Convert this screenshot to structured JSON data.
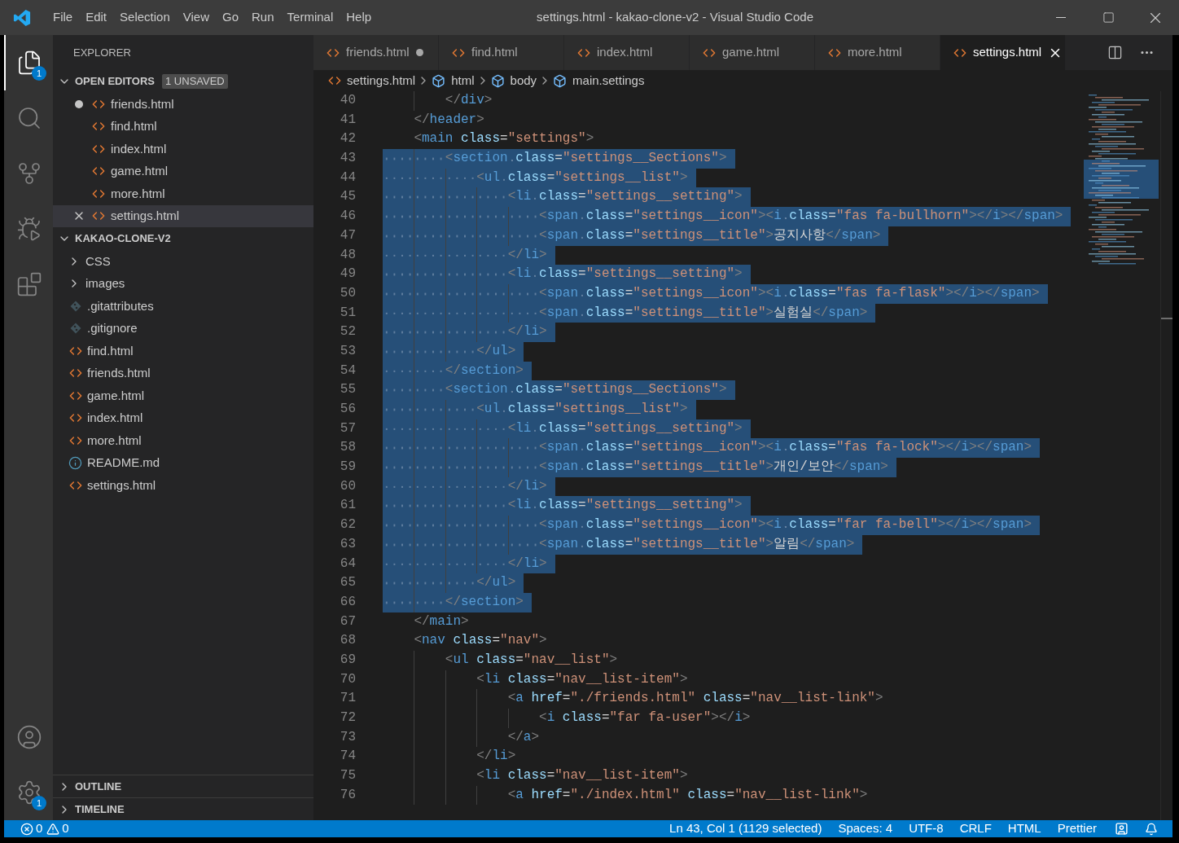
{
  "window": {
    "title": "settings.html - kakao-clone-v2 - Visual Studio Code"
  },
  "menu": [
    "File",
    "Edit",
    "Selection",
    "View",
    "Go",
    "Run",
    "Terminal",
    "Help"
  ],
  "activity_bar": [
    {
      "kind": "explorer",
      "selected": true,
      "badge": "1"
    },
    {
      "kind": "search",
      "selected": false
    },
    {
      "kind": "source_control",
      "selected": false
    },
    {
      "kind": "run",
      "selected": false
    },
    {
      "kind": "extensions",
      "selected": false
    }
  ],
  "activity_bar_bottom": [
    {
      "kind": "accounts"
    },
    {
      "kind": "settings",
      "badge": "1"
    }
  ],
  "sidebar": {
    "title": "EXPLORER",
    "open_editors": {
      "label": "OPEN EDITORS",
      "expanded": true,
      "badge": "1 UNSAVED",
      "items": [
        {
          "label": "friends.html",
          "modified": true,
          "selected": false
        },
        {
          "label": "find.html",
          "modified": false,
          "selected": false
        },
        {
          "label": "index.html",
          "modified": false,
          "selected": false
        },
        {
          "label": "game.html",
          "modified": false,
          "selected": false
        },
        {
          "label": "more.html",
          "modified": false,
          "selected": false
        },
        {
          "label": "settings.html",
          "modified": false,
          "selected": true
        }
      ]
    },
    "folder": {
      "label": "KAKAO-CLONE-V2",
      "expanded": true,
      "items": [
        {
          "label": "CSS",
          "kind": "folder",
          "expanded": false
        },
        {
          "label": "images",
          "kind": "folder",
          "expanded": false
        },
        {
          "label": ".gitattributes",
          "kind": "git"
        },
        {
          "label": ".gitignore",
          "kind": "git"
        },
        {
          "label": "find.html",
          "kind": "html"
        },
        {
          "label": "friends.html",
          "kind": "html"
        },
        {
          "label": "game.html",
          "kind": "html"
        },
        {
          "label": "index.html",
          "kind": "html"
        },
        {
          "label": "more.html",
          "kind": "html"
        },
        {
          "label": "README.md",
          "kind": "info"
        },
        {
          "label": "settings.html",
          "kind": "html"
        }
      ]
    },
    "panels": [
      {
        "label": "OUTLINE",
        "expanded": false
      },
      {
        "label": "TIMELINE",
        "expanded": false
      }
    ]
  },
  "tabs": [
    {
      "label": "friends.html",
      "selected": false,
      "modified": true
    },
    {
      "label": "find.html",
      "selected": false,
      "modified": false
    },
    {
      "label": "index.html",
      "selected": false,
      "modified": false
    },
    {
      "label": "game.html",
      "selected": false,
      "modified": false
    },
    {
      "label": "more.html",
      "selected": false,
      "modified": false
    },
    {
      "label": "settings.html",
      "selected": true,
      "modified": false
    }
  ],
  "breadcrumb": [
    {
      "label": "settings.html",
      "kind": "file"
    },
    {
      "label": "html",
      "kind": "element"
    },
    {
      "label": "body",
      "kind": "element"
    },
    {
      "label": "main.settings",
      "kind": "element"
    }
  ],
  "editor": {
    "lines": [
      {
        "number": "40",
        "code": "        </div>",
        "selected": false
      },
      {
        "number": "41",
        "code": "    </header>",
        "selected": false
      },
      {
        "number": "42",
        "code": "    <main class=\"settings\">",
        "selected": false
      },
      {
        "number": "43",
        "code": "        <section class=\"settings__Sections\">",
        "selected": true
      },
      {
        "number": "44",
        "code": "            <ul class=\"settings__list\">",
        "selected": true
      },
      {
        "number": "45",
        "code": "                <li class=\"settings__setting\">",
        "selected": true
      },
      {
        "number": "46",
        "code": "                    <span class=\"settings__icon\"><i class=\"fas fa-bullhorn\"></i></span>",
        "selected": true
      },
      {
        "number": "47",
        "code": "                    <span class=\"settings__title\">공지사항</span>",
        "selected": true
      },
      {
        "number": "48",
        "code": "                </li>",
        "selected": true
      },
      {
        "number": "49",
        "code": "                <li class=\"settings__setting\">",
        "selected": true
      },
      {
        "number": "50",
        "code": "                    <span class=\"settings__icon\"><i class=\"fas fa-flask\"></i></span>",
        "selected": true
      },
      {
        "number": "51",
        "code": "                    <span class=\"settings__title\">실험실</span>",
        "selected": true
      },
      {
        "number": "52",
        "code": "                </li>",
        "selected": true
      },
      {
        "number": "53",
        "code": "            </ul>",
        "selected": true
      },
      {
        "number": "54",
        "code": "        </section>",
        "selected": true
      },
      {
        "number": "55",
        "code": "        <section class=\"settings__Sections\">",
        "selected": true
      },
      {
        "number": "56",
        "code": "            <ul class=\"settings__list\">",
        "selected": true
      },
      {
        "number": "57",
        "code": "                <li class=\"settings__setting\">",
        "selected": true
      },
      {
        "number": "58",
        "code": "                    <span class=\"settings__icon\"><i class=\"fas fa-lock\"></i></span>",
        "selected": true
      },
      {
        "number": "59",
        "code": "                    <span class=\"settings__title\">개인/보안</span>",
        "selected": true
      },
      {
        "number": "60",
        "code": "                </li>",
        "selected": true
      },
      {
        "number": "61",
        "code": "                <li class=\"settings__setting\">",
        "selected": true
      },
      {
        "number": "62",
        "code": "                    <span class=\"settings__icon\"><i class=\"far fa-bell\"></i></span>",
        "selected": true
      },
      {
        "number": "63",
        "code": "                    <span class=\"settings__title\">알림</span>",
        "selected": true
      },
      {
        "number": "64",
        "code": "                </li>",
        "selected": true
      },
      {
        "number": "65",
        "code": "            </ul>",
        "selected": true
      },
      {
        "number": "66",
        "code": "        </section>",
        "selected": true
      },
      {
        "number": "67",
        "code": "    </main>",
        "selected": false
      },
      {
        "number": "68",
        "code": "    <nav class=\"nav\">",
        "selected": false
      },
      {
        "number": "69",
        "code": "        <ul class=\"nav__list\">",
        "selected": false
      },
      {
        "number": "70",
        "code": "            <li class=\"nav__list-item\">",
        "selected": false
      },
      {
        "number": "71",
        "code": "                <a href=\"./friends.html\" class=\"nav__list-link\">",
        "selected": false
      },
      {
        "number": "72",
        "code": "                    <i class=\"far fa-user\"></i>",
        "selected": false
      },
      {
        "number": "73",
        "code": "                </a>",
        "selected": false
      },
      {
        "number": "74",
        "code": "            </li>",
        "selected": false
      },
      {
        "number": "75",
        "code": "            <li class=\"nav__list-item\">",
        "selected": false
      },
      {
        "number": "76",
        "code": "                <a href=\"./index.html\" class=\"nav__list-link\">",
        "selected": false
      }
    ]
  },
  "status_bar": {
    "errors": "0",
    "warnings": "0",
    "items": [
      "Ln 43, Col 1 (1129 selected)",
      "Spaces: 4",
      "UTF-8",
      "CRLF",
      "HTML",
      "Prettier"
    ]
  }
}
